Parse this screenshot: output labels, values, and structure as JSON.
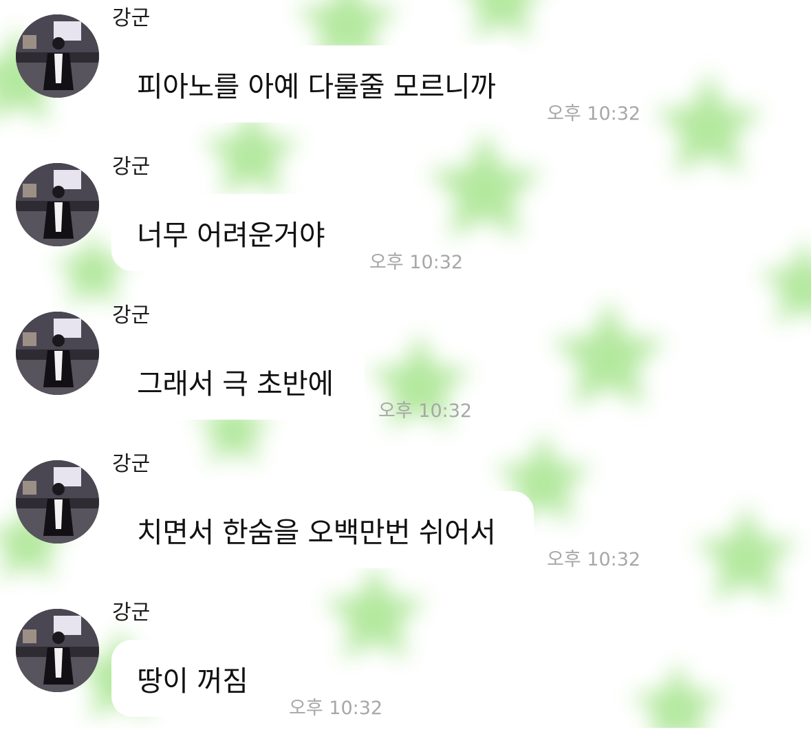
{
  "colors": {
    "background": "#ffffff",
    "star_accent": "#a6e48d",
    "bubble": "#ffffff",
    "timestamp": "#a7a7a7"
  },
  "messages": [
    {
      "sender": "강군",
      "text": "피아노를 아예 다룰줄 모르니까",
      "time": "오후 10:32",
      "avatar_icon": "profile-photo"
    },
    {
      "sender": "강군",
      "text": "너무 어려운거야",
      "time": "오후 10:32",
      "avatar_icon": "profile-photo"
    },
    {
      "sender": "강군",
      "text": "그래서 극 초반에",
      "time": "오후 10:32",
      "avatar_icon": "profile-photo"
    },
    {
      "sender": "강군",
      "text": "치면서 한숨을 오백만번 쉬어서",
      "time": "오후 10:32",
      "avatar_icon": "profile-photo"
    },
    {
      "sender": "강군",
      "text": "땅이 꺼짐",
      "time": "오후 10:32",
      "avatar_icon": "profile-photo"
    }
  ]
}
